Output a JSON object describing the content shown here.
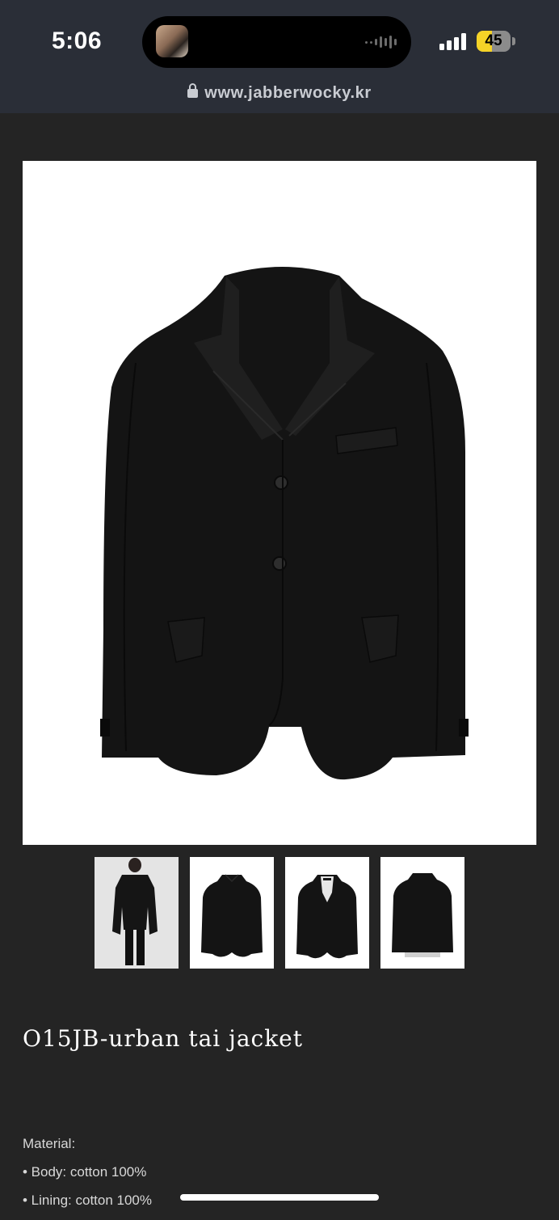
{
  "status_bar": {
    "time": "5:06",
    "battery_level": "45",
    "battery_fraction": 0.45,
    "battery_color": "#f5d327"
  },
  "browser": {
    "url": "www.jabberwocky.kr"
  },
  "product": {
    "title": "O15JB-urban tai jacket",
    "material_heading": "Material:",
    "materials": [
      "• Body: cotton 100%",
      "• Lining: cotton 100%"
    ]
  },
  "icons": {
    "lock": "lock-icon",
    "signal": "cellular-signal-icon",
    "battery": "battery-icon",
    "waveform": "audio-waveform-icon"
  },
  "colors": {
    "page_background": "#242424",
    "status_bar_background": "#2a2e37",
    "jacket": "#141414"
  }
}
